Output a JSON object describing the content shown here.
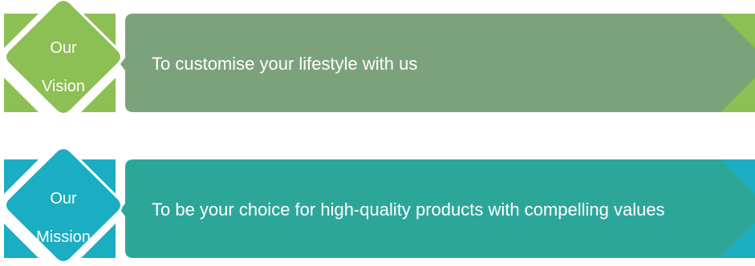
{
  "vision": {
    "badge_line1": "Our",
    "badge_line2": "Vision",
    "statement": "To customise your lifestyle with us",
    "colors": {
      "diamond": "#8cbf54",
      "corners": "#8cbf54",
      "banner": "#7ca27b"
    }
  },
  "mission": {
    "badge_line1": "Our",
    "badge_line2": "Mission",
    "statement": "To be your choice for high-quality products with compelling values",
    "colors": {
      "diamond": "#1badc1",
      "corners": "#1badc1",
      "banner": "#2da69a"
    }
  }
}
